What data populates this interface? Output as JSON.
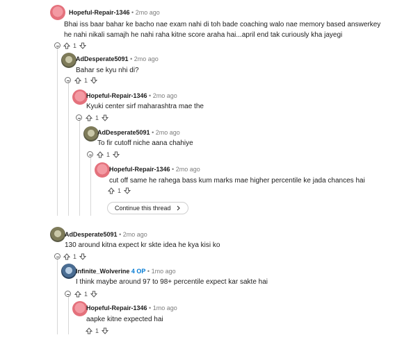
{
  "comments": [
    {
      "user": "Hopeful-Repair-1346",
      "time": "2mo ago",
      "body": "Bhai iss baar bahar ke bacho nae exam nahi di toh bade coaching walo nae memory based answerkey he nahi nikali samajh he nahi raha kitne score araha hai...april end tak curiously kha jayegi",
      "votes": "1"
    },
    {
      "user": "AdDesperate5091",
      "time": "2mo ago",
      "body": "Bahar se kyu nhi di?",
      "votes": "1"
    },
    {
      "user": "Hopeful-Repair-1346",
      "time": "2mo ago",
      "body": "Kyuki center sirf maharashtra mae the",
      "votes": "1"
    },
    {
      "user": "AdDesperate5091",
      "time": "2mo ago",
      "body": "To fir cutoff niche aana chahiye",
      "votes": "1"
    },
    {
      "user": "Hopeful-Repair-1346",
      "time": "2mo ago",
      "body": "cut off same he rahega bass kum marks mae higher percentile ke jada chances hai",
      "votes": "1"
    },
    {
      "user": "AdDesperate5091",
      "time": "2mo ago",
      "body": "130 around kitna expect kr skte idea he kya kisi ko",
      "votes": "1"
    },
    {
      "user": "Infinite_Wolverine",
      "badge": "4 OP",
      "time": "1mo ago",
      "body": "I think maybe around 97 to 98+ percentile expect kar sakte hai",
      "votes": "1"
    },
    {
      "user": "Hopeful-Repair-1346",
      "time": "1mo ago",
      "body": "aapke kitne expected hai",
      "votes": "1"
    }
  ],
  "continue_thread_label": "Continue this thread",
  "separator": "•",
  "icons": {
    "upvote": "upvote-arrow-icon",
    "downvote": "downvote-arrow-icon",
    "collapse": "collapse-minus-icon",
    "chevron": "chevron-right-icon"
  }
}
